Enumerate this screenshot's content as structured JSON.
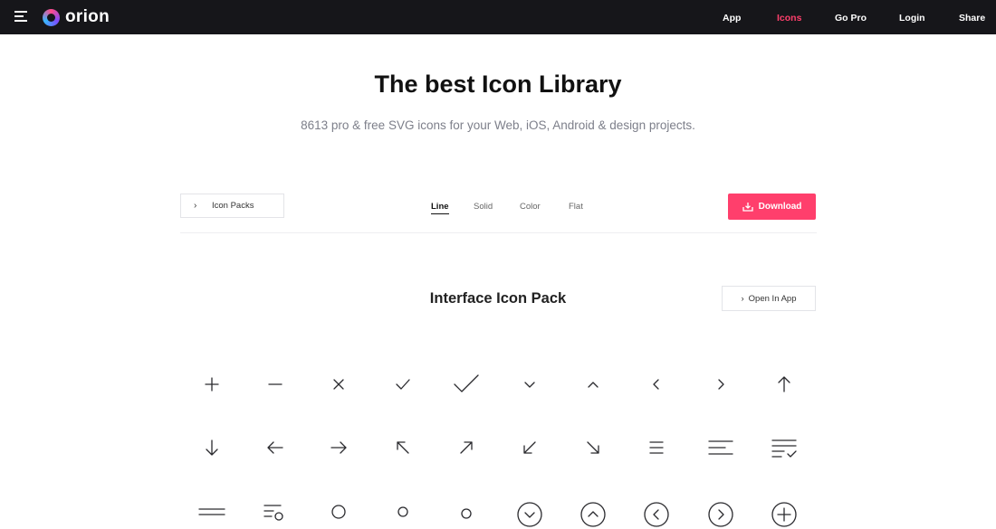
{
  "brand": {
    "name": "orion"
  },
  "nav": {
    "items": [
      {
        "label": "App"
      },
      {
        "label": "Icons",
        "active": true
      },
      {
        "label": "Go Pro"
      },
      {
        "label": "Login"
      },
      {
        "label": "Share"
      }
    ]
  },
  "hero": {
    "title": "The best Icon Library",
    "subtitle": "8613 pro & free SVG icons for your Web, iOS, Android & design projects."
  },
  "toolbar": {
    "packs_label": "Icon Packs",
    "tabs": [
      {
        "label": "Line",
        "active": true
      },
      {
        "label": "Solid"
      },
      {
        "label": "Color"
      },
      {
        "label": "Flat"
      }
    ],
    "download_label": "Download"
  },
  "pack": {
    "title": "Interface Icon Pack",
    "open_label": "Open In App"
  },
  "icons": [
    "plus-icon",
    "minus-icon",
    "close-icon",
    "check-icon",
    "check-large-icon",
    "chevron-down-icon",
    "chevron-up-icon",
    "chevron-left-icon",
    "chevron-right-icon",
    "arrow-up-icon",
    "arrow-down-icon",
    "arrow-left-icon",
    "arrow-right-icon",
    "arrow-up-left-icon",
    "arrow-up-right-icon",
    "arrow-down-left-icon",
    "arrow-down-right-icon",
    "menu-icon",
    "text-align-icon",
    "checklist-icon",
    "menu-two-line-icon",
    "list-search-icon",
    "search-icon",
    "zoom-icon",
    "circle-icon",
    "circle-chevron-down-icon",
    "circle-chevron-up-icon",
    "circle-chevron-left-icon",
    "circle-chevron-right-icon",
    "circle-plus-icon"
  ],
  "colors": {
    "topbar": "#16161a",
    "accent": "#ff3f6c",
    "subtitle": "#7d7f8a"
  }
}
